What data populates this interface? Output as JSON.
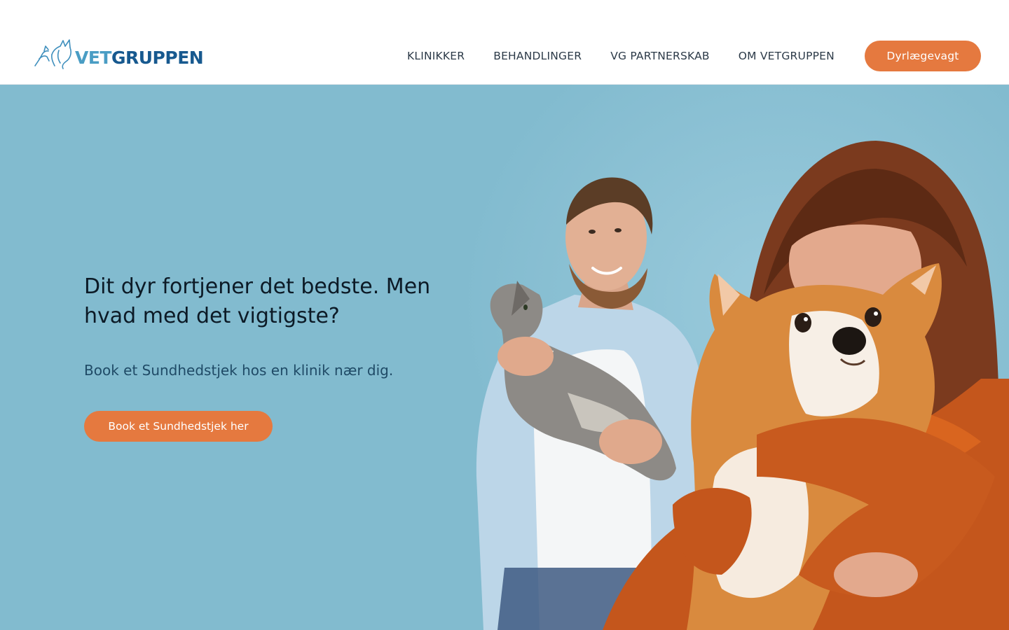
{
  "header": {
    "logo": {
      "part1": "VET",
      "part2": "GRUPPEN",
      "icon": "animals-outline-logo-icon",
      "color_light": "#4a9dc4",
      "color_dark": "#17598f"
    },
    "nav": [
      {
        "label": "KLINIKKER"
      },
      {
        "label": "BEHANDLINGER"
      },
      {
        "label": "VG PARTNERSKAB"
      },
      {
        "label": "OM VETGRUPPEN"
      }
    ],
    "cta_label": "Dyrlægevagt"
  },
  "hero": {
    "title": "Dit dyr fortjener det bedste. Men hvad med det vigtigste?",
    "subtitle": "Book et Sundhedstjek hos en klinik nær dig.",
    "button_label": "Book et Sundhedstjek her",
    "image": "man-with-cat-and-woman-hugging-corgi-photo"
  },
  "colors": {
    "accent": "#e5793f",
    "hero_background": "#82bbcf",
    "text_dark": "#0c1a26",
    "subtitle": "#1f4a66"
  }
}
